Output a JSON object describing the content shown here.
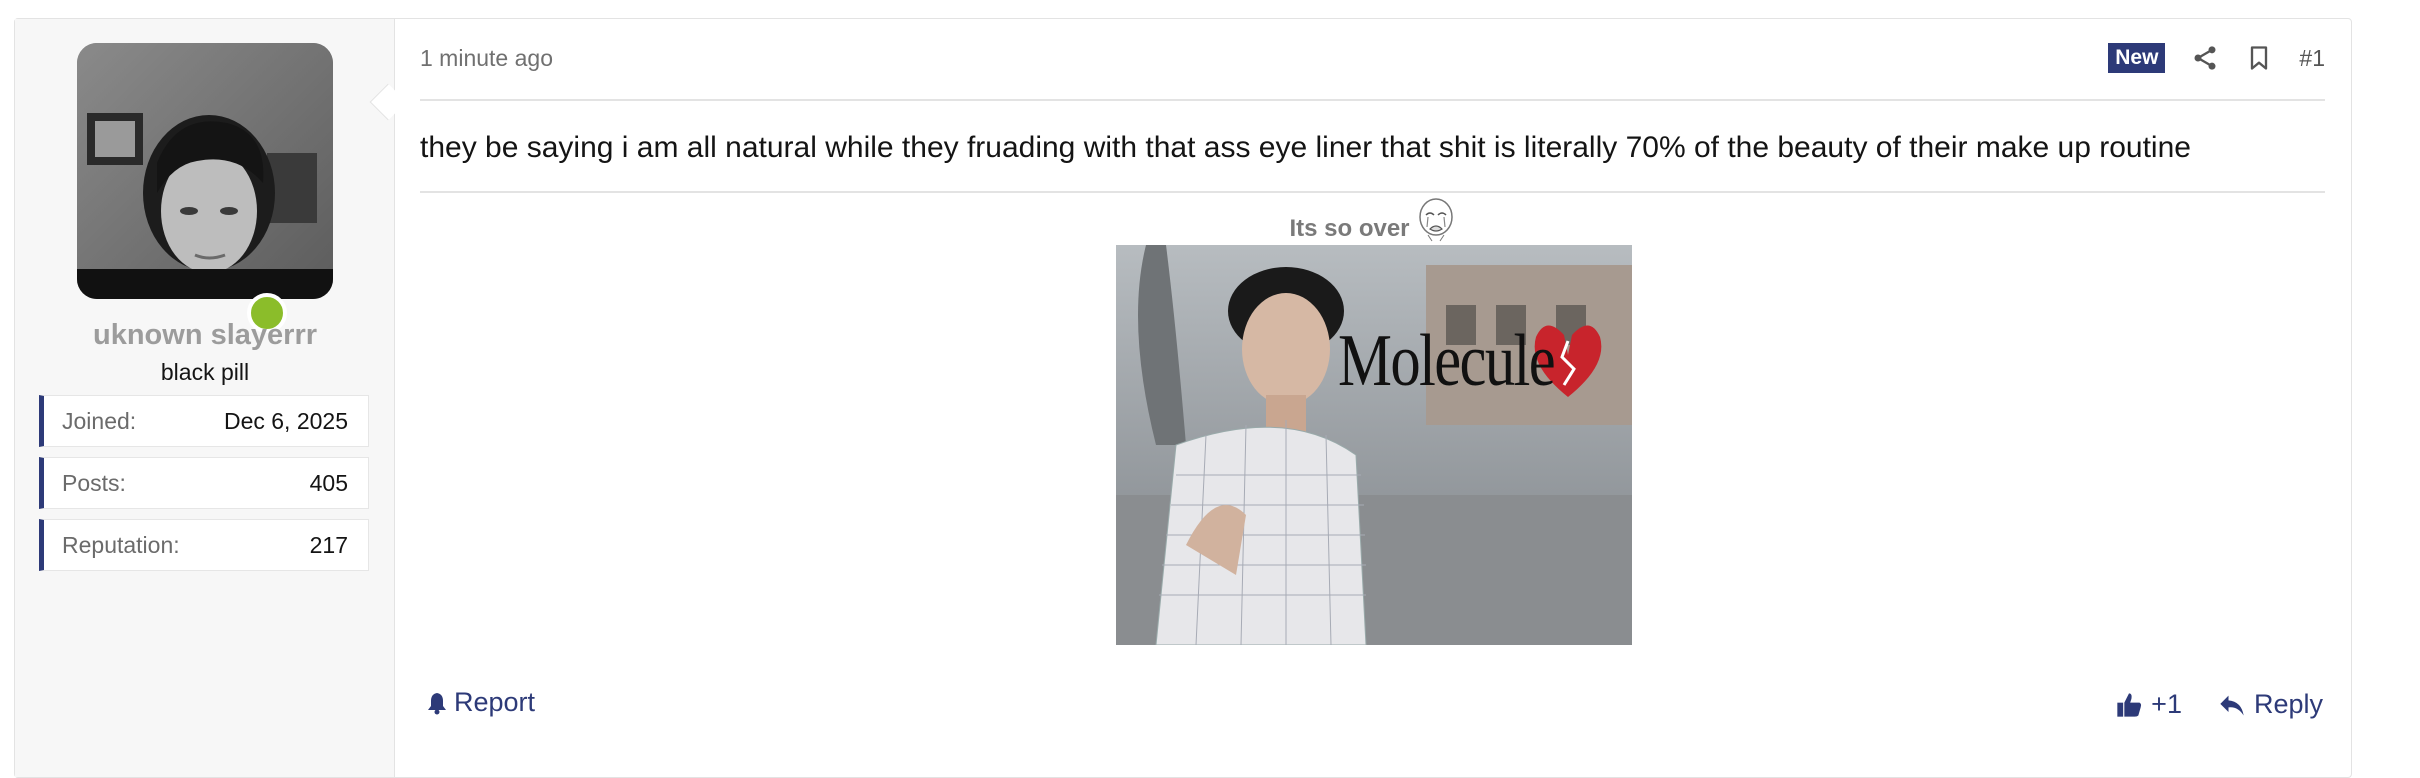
{
  "post": {
    "timestamp": "1 minute ago",
    "new_badge": "New",
    "post_number": "#1",
    "body": "they be saying i am all natural while they fruading with that ass eye liner that shit is literally 70% of the beauty of their make up routine"
  },
  "user": {
    "username": "uknown slayerrr",
    "title": "black pill",
    "online_color": "#8bbd2a",
    "stats": [
      {
        "label": "Joined:",
        "value": "Dec 6, 2025"
      },
      {
        "label": "Posts:",
        "value": "405"
      },
      {
        "label": "Reputation:",
        "value": "217"
      }
    ]
  },
  "signature": {
    "text": "Its so over",
    "image_caption": "Molecule"
  },
  "footer": {
    "report_label": "Report",
    "like_count": "+1",
    "reply_label": "Reply"
  },
  "icons": {
    "share": "share-icon",
    "bookmark": "bookmark-icon",
    "report": "bell-icon",
    "like": "thumbs-up-icon",
    "reply": "reply-icon",
    "wojak": "crying-face-icon",
    "heart": "broken-heart-icon"
  },
  "colors": {
    "accent": "#2d3a78",
    "username": "#9c9c9c",
    "border": "#e3e3e3"
  }
}
